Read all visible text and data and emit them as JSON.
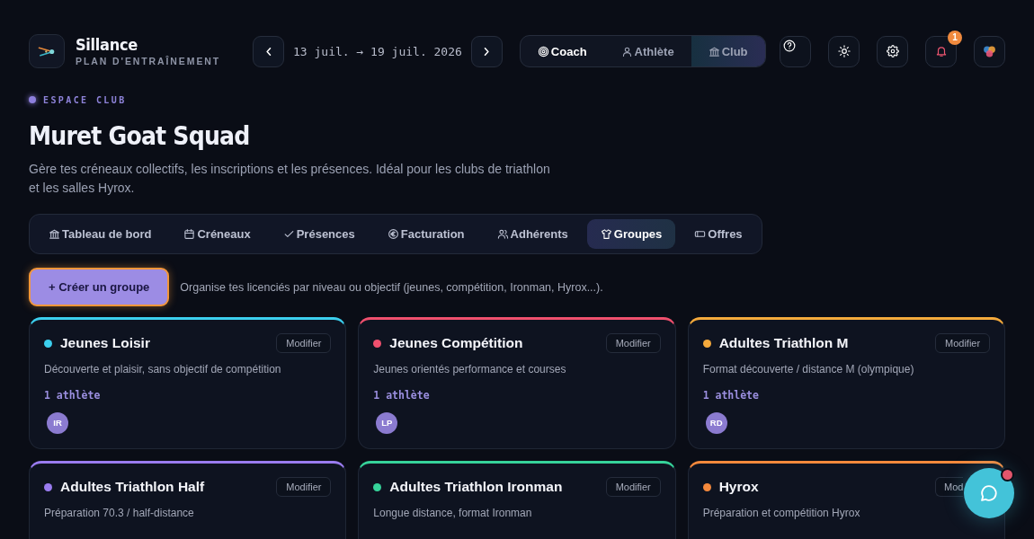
{
  "brand": {
    "name": "Sillance",
    "tagline": "PLAN D'ENTRAÎNEMENT"
  },
  "week_nav": {
    "range": "13 juil. → 19 juil. 2026"
  },
  "view_switch": [
    {
      "label": "Coach",
      "active": true,
      "selected": false
    },
    {
      "label": "Athlète",
      "active": false,
      "selected": false
    },
    {
      "label": "Club",
      "active": false,
      "selected": true
    }
  ],
  "notifications": {
    "count": "1"
  },
  "section": {
    "eyebrow": "ESPACE CLUB",
    "title": "Muret Goat Squad",
    "description": "Gère tes créneaux collectifs, les inscriptions et les présences. Idéal pour les clubs de triathlon et les salles Hyrox."
  },
  "tabs": [
    {
      "label": "Tableau de bord",
      "selected": false
    },
    {
      "label": "Créneaux",
      "selected": false
    },
    {
      "label": "Présences",
      "selected": false
    },
    {
      "label": "Facturation",
      "selected": false
    },
    {
      "label": "Adhérents",
      "selected": false
    },
    {
      "label": "Groupes",
      "selected": true
    },
    {
      "label": "Offres",
      "selected": false
    }
  ],
  "create_button": {
    "label": "+ Créer un groupe",
    "focused": true
  },
  "helper_text": "Organise tes licenciés par niveau ou objectif (jeunes, compétition, Ironman, Hyrox...).",
  "groups": [
    {
      "name": "Jeunes Loisir",
      "color": "#3ccfee",
      "edit_label": "Modifier",
      "edit_cut_off": false,
      "description": "Découverte et plaisir, sans objectif de compétition",
      "athletes": "1 athlète",
      "members": [
        "IR"
      ]
    },
    {
      "name": "Jeunes Compétition",
      "color": "#f0506e",
      "edit_label": "Modifier",
      "edit_cut_off": false,
      "description": "Jeunes orientés performance et courses",
      "athletes": "1 athlète",
      "members": [
        "LP"
      ]
    },
    {
      "name": "Adultes Triathlon M",
      "color": "#f5aa3c",
      "edit_label": "Modifier",
      "edit_cut_off": false,
      "description": "Format découverte / distance M (olympique)",
      "athletes": "1 athlète",
      "members": [
        "RD"
      ]
    },
    {
      "name": "Adultes Triathlon Half",
      "color": "#9a7cf0",
      "edit_label": "Modifier",
      "edit_cut_off": false,
      "description": "Préparation 70.3 / half-distance"
    },
    {
      "name": "Adultes Triathlon Ironman",
      "color": "#36d39a",
      "edit_label": "Modifier",
      "edit_cut_off": false,
      "description": "Longue distance, format Ironman"
    },
    {
      "name": "Hyrox",
      "color": "#f5893c",
      "edit_label": "Mod",
      "edit_cut_off": true,
      "description": "Préparation et compétition Hyrox"
    }
  ]
}
